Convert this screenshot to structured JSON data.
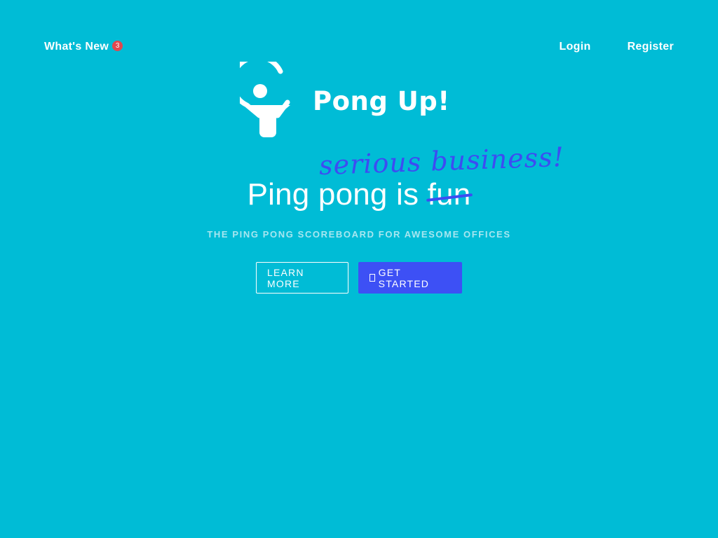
{
  "nav": {
    "whats_new_label": "What's New",
    "whats_new_badge": "3",
    "login_label": "Login",
    "register_label": "Register"
  },
  "logo": {
    "text": "Pong Up!",
    "icon": "ping-pong-paddle-icon"
  },
  "hero": {
    "headline_prefix": "Ping pong is ",
    "headline_struck": "fun",
    "scribble": "serious business!",
    "subtitle": "THE PING PONG SCOREBOARD FOR AWESOME OFFICES"
  },
  "buttons": {
    "learn_more_label": "LEARN MORE",
    "get_started_label": "GET STARTED",
    "get_started_icon": "missing-glyph-icon"
  },
  "colors": {
    "background": "#00bcd6",
    "accent": "#3d50f5",
    "badge": "#e0474f",
    "subtitle": "#a8e6f0"
  }
}
